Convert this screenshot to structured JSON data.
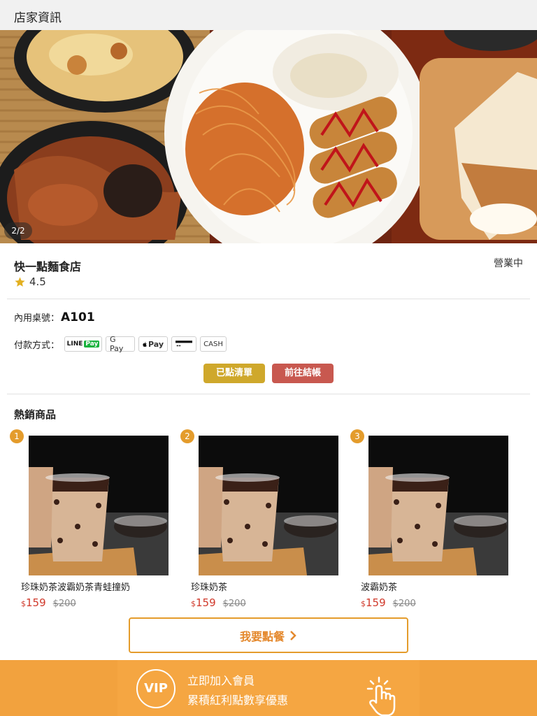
{
  "header": {
    "title": "店家資訊"
  },
  "hero": {
    "counter": "2/2"
  },
  "store": {
    "name": "快一點麵食店",
    "status": "營業中",
    "rating": "4.5"
  },
  "table": {
    "label": "內用桌號：",
    "value": "A101"
  },
  "payment": {
    "label": "付款方式：",
    "methods": {
      "line_pay": "LINE",
      "line_pay_tag": "Pay",
      "google_pay": "G Pay",
      "apple_pay": "Pay",
      "card": "",
      "cash": "CASH"
    }
  },
  "actions": {
    "ordered_list": "已點清單",
    "checkout": "前往結帳"
  },
  "bestsellers": {
    "title": "熱銷商品",
    "items": [
      {
        "rank": "1",
        "name": "珍珠奶茶波霸奶茶青蛙撞奶",
        "currency": "$",
        "price": "159",
        "original_price": "$200"
      },
      {
        "rank": "2",
        "name": "珍珠奶茶",
        "currency": "$",
        "price": "159",
        "original_price": "$200"
      },
      {
        "rank": "3",
        "name": "波霸奶茶",
        "currency": "$",
        "price": "159",
        "original_price": "$200"
      }
    ]
  },
  "order_button": {
    "label": "我要點餐",
    "icon": "chevron-right-icon"
  },
  "vip": {
    "badge": "VIP",
    "line1": "立即加入會員",
    "line2": "累積紅利點數享優惠",
    "icon": "tap-hand-icon"
  },
  "colors": {
    "accent": "#e49c2c",
    "ordered": "#cfa82b",
    "checkout": "#c8584f",
    "price": "#d0392b",
    "vip_bg": "#f2a23e"
  }
}
